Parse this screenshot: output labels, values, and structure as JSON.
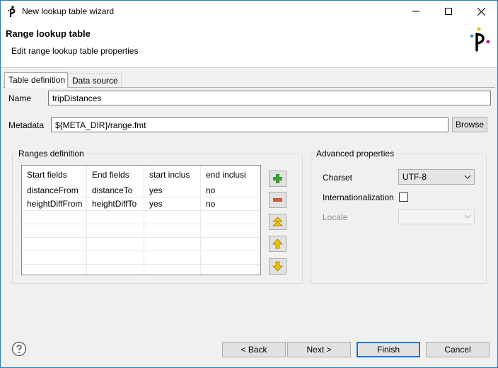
{
  "window": {
    "title": "New lookup table wizard"
  },
  "header": {
    "title": "Range lookup table",
    "subtitle": "Edit range lookup table properties"
  },
  "tabs": [
    {
      "label": "Table definition",
      "active": true
    },
    {
      "label": "Data source",
      "active": false
    }
  ],
  "form": {
    "name_label": "Name",
    "name_value": "tripDistances",
    "metadata_label": "Metadata",
    "metadata_value": "${META_DIR}/range.fmt",
    "browse_label": "Browse"
  },
  "ranges": {
    "group_title": "Ranges definition",
    "columns": [
      "Start fields",
      "End fields",
      "start inclus",
      "end inclusi"
    ],
    "rows": [
      [
        "distanceFrom",
        "distanceTo",
        "yes",
        "no"
      ],
      [
        "heightDiffFrom",
        "heightDiffTo",
        "yes",
        "no"
      ]
    ],
    "buttons": [
      "add-icon",
      "remove-icon",
      "move-top-icon",
      "move-up-icon",
      "move-down-icon"
    ]
  },
  "advanced": {
    "group_title": "Advanced properties",
    "charset_label": "Charset",
    "charset_value": "UTF-8",
    "internationalization_label": "Internationalization",
    "internationalization_checked": false,
    "locale_label": "Locale",
    "locale_value": ""
  },
  "footer": {
    "back_label": "< Back",
    "next_label": "Next >",
    "finish_label": "Finish",
    "cancel_label": "Cancel"
  },
  "colors": {
    "accent": "#0078d7",
    "add_green": "#3aa53a",
    "remove_red": "#e05a3a",
    "arrow_yellow": "#f2c200"
  }
}
